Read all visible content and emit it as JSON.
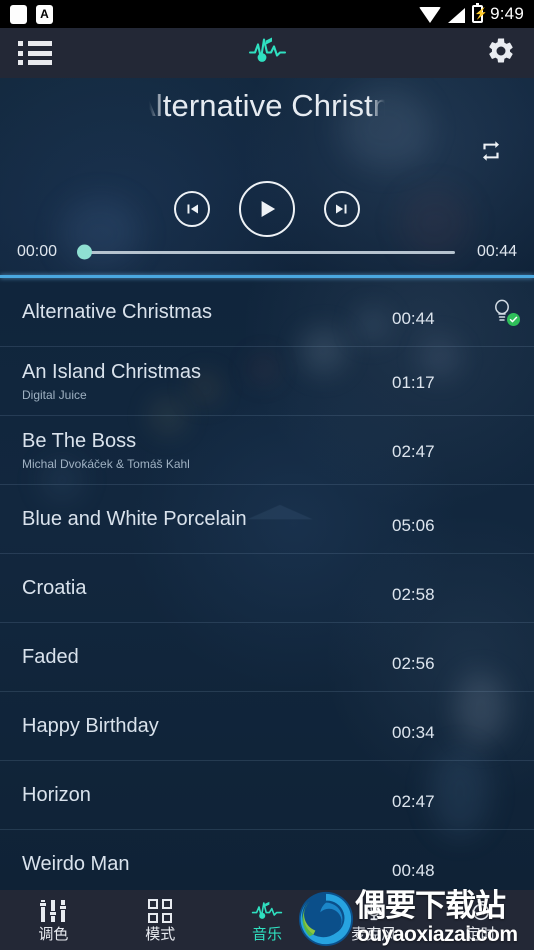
{
  "status_bar": {
    "time": "9:49",
    "icons": [
      "white-square-icon",
      "letter-a-icon",
      "wifi-icon",
      "signal-icon",
      "battery-charging-icon"
    ]
  },
  "app_bar": {
    "menu_icon": "list-icon",
    "logo_icon": "music-note-wave-icon",
    "settings_icon": "gear-icon"
  },
  "player": {
    "title": "Alternative Christmas",
    "title_visible": "lternative C",
    "repeat_icon": "repeat-icon",
    "prev_icon": "skip-previous-icon",
    "play_icon": "play-icon",
    "next_icon": "skip-next-icon",
    "elapsed": "00:00",
    "duration": "00:44",
    "progress_percent": 0,
    "accent_color": "#8fe0d2",
    "divider_color": "#4aa8e0"
  },
  "tracks": [
    {
      "title": "Alternative Christmas",
      "artist": "",
      "duration": "00:44",
      "badge": "microphone-check-icon",
      "selected": true
    },
    {
      "title": "An Island Christmas",
      "artist": "Digital Juice",
      "duration": "01:17",
      "badge": "",
      "selected": false
    },
    {
      "title": "Be The Boss",
      "artist": "Michal Dvoƙáček & Tomáš Kahl",
      "duration": "02:47",
      "badge": "",
      "selected": false
    },
    {
      "title": "Blue and White Porcelain",
      "artist": "",
      "duration": "05:06",
      "badge": "",
      "selected": false
    },
    {
      "title": "Croatia",
      "artist": "",
      "duration": "02:58",
      "badge": "",
      "selected": false
    },
    {
      "title": "Faded",
      "artist": "",
      "duration": "02:56",
      "badge": "",
      "selected": false
    },
    {
      "title": "Happy Birthday",
      "artist": "",
      "duration": "00:34",
      "badge": "",
      "selected": false
    },
    {
      "title": "Horizon",
      "artist": "",
      "duration": "02:47",
      "badge": "",
      "selected": false
    },
    {
      "title": "Weirdo Man",
      "artist": "",
      "duration": "00:48",
      "badge": "",
      "selected": false
    }
  ],
  "bottom_nav": {
    "active_color": "#2fe0c0",
    "items": [
      {
        "label": "调色",
        "icon": "sliders-icon",
        "active": false
      },
      {
        "label": "模式",
        "icon": "grid-icon",
        "active": false
      },
      {
        "label": "音乐",
        "icon": "music-note-wave-icon",
        "active": true
      },
      {
        "label": "麦克风",
        "icon": "microphone-icon",
        "active": false
      },
      {
        "label": "定时",
        "icon": "timer-icon",
        "active": false
      }
    ]
  },
  "watermark": {
    "chinese": "偶要下载站",
    "url": "ouyaoxiazai.com",
    "logo_icon": "swirl-logo-icon"
  }
}
